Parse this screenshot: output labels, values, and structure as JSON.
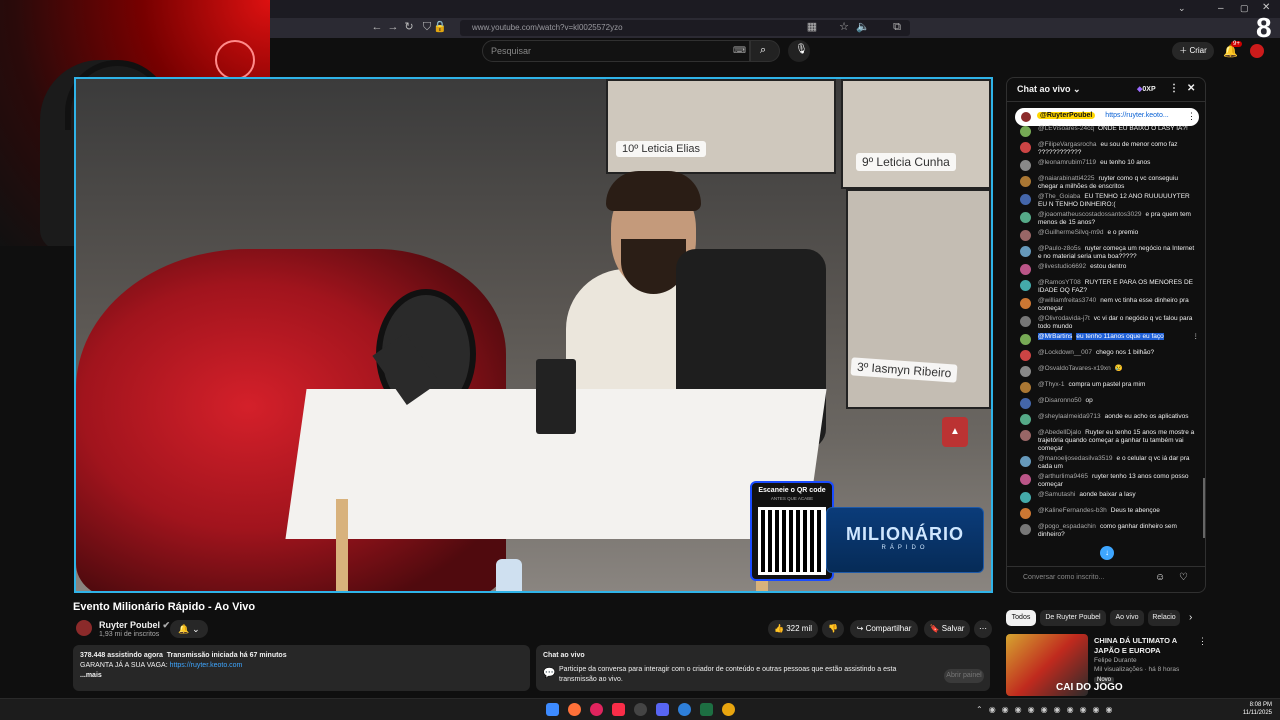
{
  "browser": {
    "url": "www.youtube.com/watch?v=kl0025572yzo"
  },
  "header": {
    "search_placeholder": "Pesquisar",
    "create_label": "Criar",
    "notifications_badge": "9+"
  },
  "video": {
    "screen_names": [
      "Leticia Elias",
      "Leticia Cunha",
      "Iasmyn Ribeiro"
    ],
    "screen_numbers": [
      "10",
      "9",
      "3"
    ],
    "qr_title": "Escaneie o QR code",
    "qr_subtitle": "ANTES QUE ACABE",
    "brand_main": "MILIONÁRIO",
    "brand_sub": "RÁPIDO"
  },
  "info": {
    "title": "Evento Milionário Rápido - Ao Vivo",
    "channel_name": "Ruyter Poubel",
    "subscribers": "1,93 mi de inscritos",
    "likes": "322 mil",
    "share_label": "Compartilhar",
    "save_label": "Salvar",
    "viewers": "378.448 assistindo agora",
    "started": "Transmissão iniciada há 67 minutos",
    "vaga_text": "GARANTA JÁ A SUA VAGA:",
    "vaga_link": "https://ruyter.keoto.com",
    "more": "...mais"
  },
  "chat_info": {
    "title": "Chat ao vivo",
    "text": "Participe da conversa para interagir com o criador de conteúdo e outras pessoas que estão assistindo a esta transmissão ao vivo.",
    "open_panel": "Abrir painel"
  },
  "chat": {
    "title": "Chat ao vivo",
    "xp": "0XP",
    "pinned_author": "@RuyterPoubel",
    "pinned_link": "https://ruyter.keoto...",
    "input_placeholder": "Conversar como inscrito...",
    "messages": [
      {
        "author": "@LEVisoares-24cq",
        "text": "ONDE EU BAIXO O LASY IA?!"
      },
      {
        "author": "@FilipeVargasrocha",
        "text": "eu sou de menor como faz ????????????"
      },
      {
        "author": "@leonamrubim7119",
        "text": "eu tenho 10 anos"
      },
      {
        "author": "@naiarabinatti4225",
        "text": "ruyter como q vc conseguiu chegar a milhões de enscritos"
      },
      {
        "author": "@The_Goiaba",
        "text": "EU TENHO 12 ANO RUUUUUYTER EU N TENHO DINHEIRO:("
      },
      {
        "author": "@joaomatheuscostadossantos3029",
        "text": "e pra quem tem menos de 15 anos?"
      },
      {
        "author": "@GuilhermeSilvq-m9d",
        "text": "e o premio"
      },
      {
        "author": "@Paulo-z8o5s",
        "text": "ruyter começa um negócio na Internet e no material seria uma boa?????"
      },
      {
        "author": "@livestudio6692",
        "text": "estou dentro"
      },
      {
        "author": "@RamosYT08",
        "text": "RUYTER E PARA OS MENORES DE IDADE OQ FAZ?"
      },
      {
        "author": "@williamfreitas3740",
        "text": "nem vc tinha esse dinheiro pra começar"
      },
      {
        "author": "@Olivrodavida-j7t",
        "text": "vc vi dar o negócio q vc falou para todo mundo"
      },
      {
        "author": "@MrBartins",
        "text": "eu tenho 11anos oque eu faço",
        "highlight": true
      },
      {
        "author": "@Lockdown__007",
        "text": "chego nos 1 bilhão?"
      },
      {
        "author": "@OsvaldoTavares-x19xn",
        "text": "😢"
      },
      {
        "author": "@Thyx-1",
        "text": "compra um pastel pra mim"
      },
      {
        "author": "@Disaronno50",
        "text": "op"
      },
      {
        "author": "@sheylaalmeida9713",
        "text": "aonde eu acho os aplicativos"
      },
      {
        "author": "@AbedellDjalo",
        "text": "Ruyter eu tenho 15 anos me mostre a trajetória quando começar a ganhar tu também vai começar"
      },
      {
        "author": "@manoeljosedasilva3519",
        "text": "e o celular q vc iá dar pra cada um"
      },
      {
        "author": "@arthurlima9465",
        "text": "ruyter tenho 13 anos como posso começar"
      },
      {
        "author": "@Samutashi",
        "text": "aonde baixar a lasy"
      },
      {
        "author": "@KalineFernandes-b3h",
        "text": "Deus te abençoe"
      },
      {
        "author": "@pogo_espadachin",
        "text": "como ganhar dinheiro sem dinheiro?"
      }
    ]
  },
  "chips": [
    "Todos",
    "De Ruyter Poubel",
    "Ao vivo",
    "Relacio"
  ],
  "recommendation": {
    "title": "CHINA DÁ ULTIMATO A JAPÃO E EUROPA",
    "channel": "Felipe Durante",
    "meta": "Mil visualizações · há 8 horas",
    "badge": "Novo",
    "thumb_text": "CAI DO JOGO"
  },
  "taskbar": {
    "time": "8:08 PM",
    "date": "11/11/2025"
  },
  "colors": {
    "accent": "#2fb3e8",
    "highlight": "#1e5fd6",
    "brand": "#0b3c7a"
  }
}
